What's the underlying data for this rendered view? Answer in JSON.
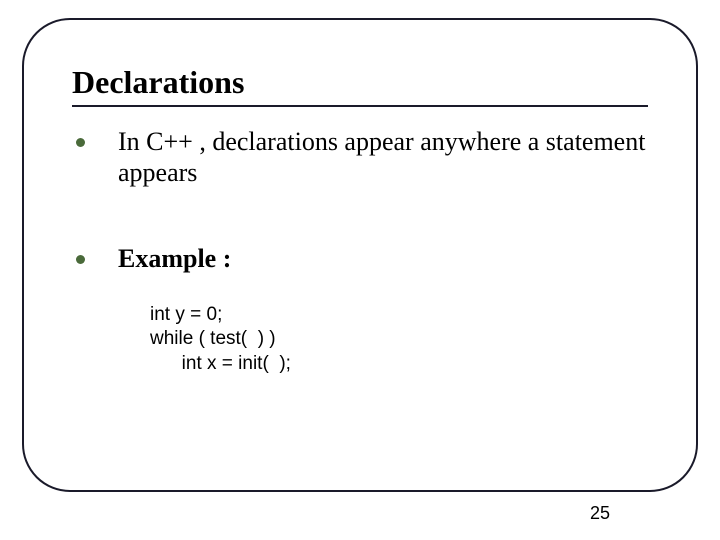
{
  "title": "Declarations",
  "bullets": [
    {
      "text": "In C++ , declarations appear anywhere a statement appears",
      "bold": false
    },
    {
      "text": "Example :",
      "bold": true
    }
  ],
  "code": "int y = 0;\nwhile ( test(  ) )\n      int x = init(  );",
  "page_number": "25"
}
